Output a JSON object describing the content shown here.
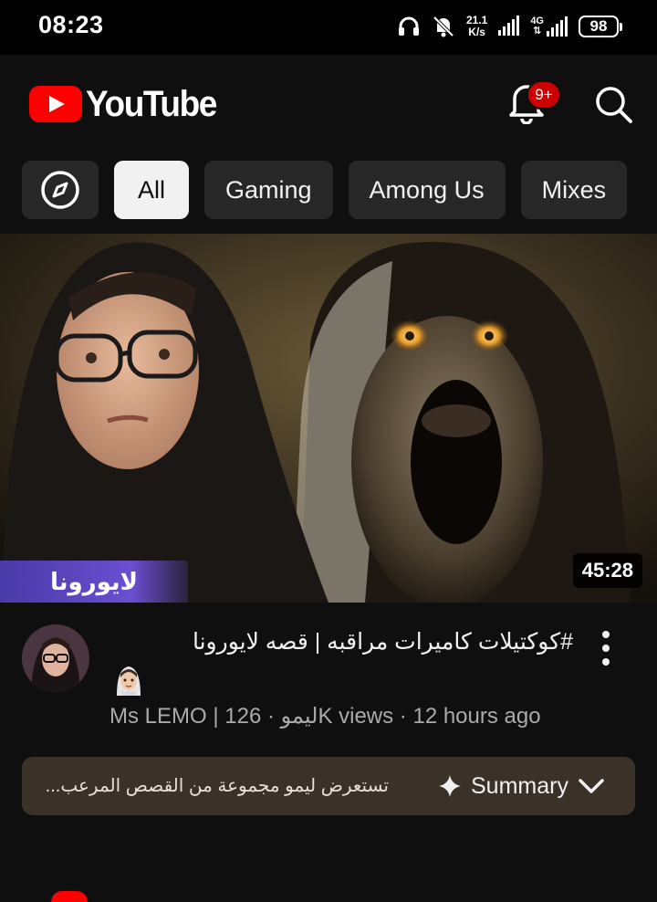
{
  "status_bar": {
    "time": "08:23",
    "net_speed_value": "21.1",
    "net_speed_unit": "K/s",
    "network_type": "4G",
    "battery": "98",
    "icons": [
      "headphones-icon",
      "bell-off-icon",
      "signal-icon",
      "lte-signal-icon",
      "battery-icon"
    ]
  },
  "header": {
    "logo_text": "YouTube",
    "notification_count": "9+",
    "colors": {
      "brand": "#ff0000",
      "badge": "#cc0000"
    }
  },
  "chips": {
    "items": [
      {
        "label": "All",
        "active": true
      },
      {
        "label": "Gaming",
        "active": false
      },
      {
        "label": "Among Us",
        "active": false
      },
      {
        "label": "Mixes",
        "active": false
      }
    ]
  },
  "video": {
    "thumbnail_caption": "لايورونا",
    "duration": "45:28",
    "title": "#كوكتيلات  كاميرات مراقبه | قصه لايورونا",
    "meta": "Ms LEMO | ليمو · 126K views · 12 hours ago"
  },
  "summary": {
    "preview_text": "تستعرض ليمو مجموعة من القصص المرعب...",
    "label": "Summary"
  }
}
